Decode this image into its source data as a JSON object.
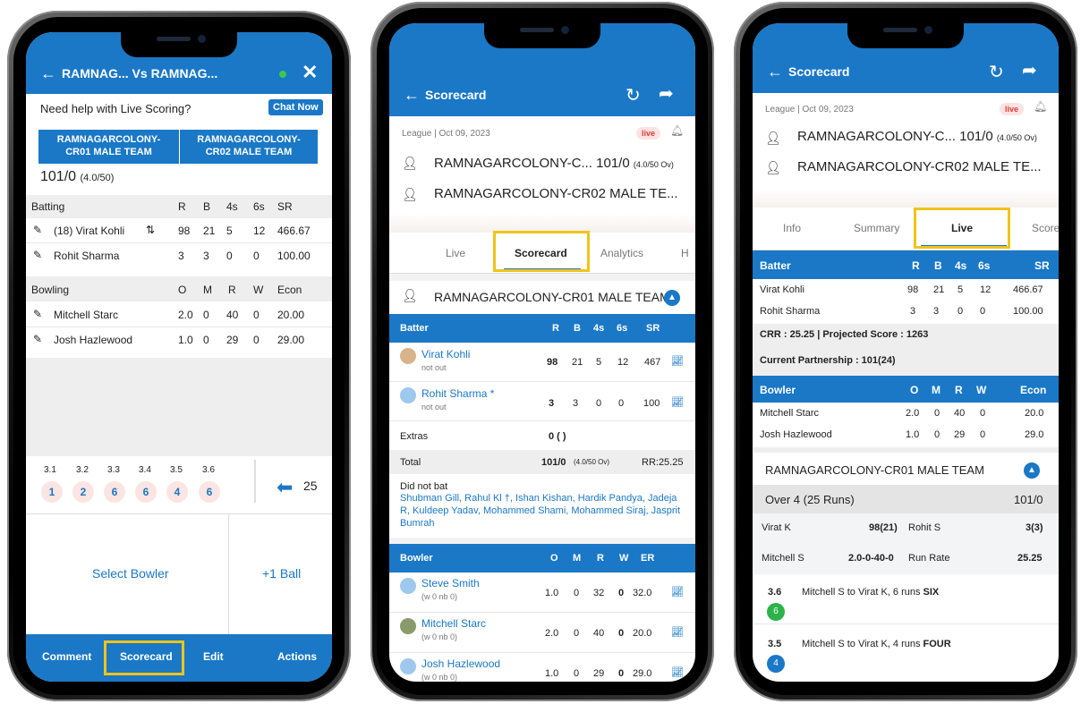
{
  "colors": {
    "accent": "#1a78c6",
    "highlight": "#f0c419",
    "live": "#e53935"
  },
  "p1": {
    "header_title": "RAMNAG... Vs RAMNAG...",
    "help_text": "Need help with Live Scoring?",
    "chat_now": "Chat Now",
    "team1": "RAMNAGARCOLONY-\nCR01 MALE TEAM",
    "team2": "RAMNAGARCOLONY-\nCR02 MALE TEAM",
    "score": "101/0",
    "overs": "(4.0/50)",
    "batting_headers": [
      "Batting",
      "R",
      "B",
      "4s",
      "6s",
      "SR"
    ],
    "batters": [
      {
        "name": "(18) Virat Kohli",
        "r": "98",
        "b": "21",
        "f": "5",
        "s": "12",
        "sr": "466.67"
      },
      {
        "name": "Rohit Sharma",
        "r": "3",
        "b": "3",
        "f": "0",
        "s": "0",
        "sr": "100.00"
      }
    ],
    "bowling_headers": [
      "Bowling",
      "O",
      "M",
      "R",
      "W",
      "Econ"
    ],
    "bowlers": [
      {
        "name": "Mitchell Starc",
        "o": "2.0",
        "m": "0",
        "r": "40",
        "w": "0",
        "e": "20.00"
      },
      {
        "name": "Josh Hazlewood",
        "o": "1.0",
        "m": "0",
        "r": "29",
        "w": "0",
        "e": "29.00"
      }
    ],
    "balls": [
      {
        "label": "3.1",
        "val": "1"
      },
      {
        "label": "3.2",
        "val": "2"
      },
      {
        "label": "3.3",
        "val": "6"
      },
      {
        "label": "3.4",
        "val": "6"
      },
      {
        "label": "3.5",
        "val": "4"
      },
      {
        "label": "3.6",
        "val": "6"
      }
    ],
    "undo_count": "25",
    "select_bowler": "Select Bowler",
    "plus_ball": "+1 Ball",
    "nav": [
      "Comment",
      "Scorecard",
      "Edit",
      "Actions"
    ]
  },
  "p2": {
    "header_title": "Scorecard",
    "meta": "League | Oct 09, 2023",
    "live": "live",
    "team1": "RAMNAGARCOLONY-C...",
    "team1_score": "101/0",
    "team1_overs": "(4.0/50 Ov)",
    "team2": "RAMNAGARCOLONY-CR02 MALE TE...",
    "tabs": [
      "Live",
      "Scorecard",
      "Analytics",
      "H"
    ],
    "innings_team": "RAMNAGARCOLONY-CR01 MALE TEAM",
    "batter_headers": [
      "Batter",
      "R",
      "B",
      "4s",
      "6s",
      "SR"
    ],
    "batters": [
      {
        "name": "Virat Kohli",
        "status": "not out",
        "r": "98",
        "b": "21",
        "f": "5",
        "s": "12",
        "sr": "467"
      },
      {
        "name": "Rohit Sharma *",
        "status": "not out",
        "r": "3",
        "b": "3",
        "f": "0",
        "s": "0",
        "sr": "100"
      }
    ],
    "extras_label": "Extras",
    "extras_value": "0 ( )",
    "total_label": "Total",
    "total_value": "101/0",
    "total_overs": "(4.0/50 Ov)",
    "rr": "RR:25.25",
    "dnb_label": "Did not bat",
    "dnb_list": "Shubman Gill, Rahul Kl †, Ishan Kishan, Hardik Pandya, Jadeja R, Kuldeep Yadav, Mohammed Shami, Mohammed Siraj, Jasprit Bumrah",
    "bowler_headers": [
      "Bowler",
      "O",
      "M",
      "R",
      "W",
      "ER"
    ],
    "bowlers": [
      {
        "name": "Steve Smith",
        "sub": "(w 0 nb 0)",
        "o": "1.0",
        "m": "0",
        "r": "32",
        "w": "0",
        "er": "32.0"
      },
      {
        "name": "Mitchell Starc",
        "sub": "(w 0 nb 0)",
        "o": "2.0",
        "m": "0",
        "r": "40",
        "w": "0",
        "er": "20.0"
      },
      {
        "name": "Josh Hazlewood",
        "sub": "(w 0 nb 0)",
        "o": "1.0",
        "m": "0",
        "r": "29",
        "w": "0",
        "er": "29.0"
      }
    ]
  },
  "p3": {
    "header_title": "Scorecard",
    "meta": "League | Oct 09, 2023",
    "live": "live",
    "team1": "RAMNAGARCOLONY-C...",
    "team1_score": "101/0",
    "team1_overs": "(4.0/50 Ov)",
    "team2": "RAMNAGARCOLONY-CR02 MALE TE...",
    "tabs": [
      "Info",
      "Summary",
      "Live",
      "Score"
    ],
    "batter_headers": [
      "Batter",
      "R",
      "B",
      "4s",
      "6s",
      "SR"
    ],
    "batters": [
      {
        "name": "Virat Kohli",
        "r": "98",
        "b": "21",
        "f": "5",
        "s": "12",
        "sr": "466.67"
      },
      {
        "name": "Rohit Sharma",
        "r": "3",
        "b": "3",
        "f": "0",
        "s": "0",
        "sr": "100.00"
      }
    ],
    "crr": "CRR : 25.25 | Projected Score : 1263",
    "partnership": "Current Partnership : 101(24)",
    "bowler_headers": [
      "Bowler",
      "O",
      "M",
      "R",
      "W",
      "Econ"
    ],
    "bowlers": [
      {
        "name": "Mitchell Starc",
        "o": "2.0",
        "m": "0",
        "r": "40",
        "w": "0",
        "e": "20.0"
      },
      {
        "name": "Josh Hazlewood",
        "o": "1.0",
        "m": "0",
        "r": "29",
        "w": "0",
        "e": "29.0"
      }
    ],
    "innings_team": "RAMNAGARCOLONY-CR01 MALE TEAM",
    "over_label": "Over 4 (25 Runs)",
    "over_score": "101/0",
    "p_bat1": "Virat K",
    "p_bat1_val": "98(21)",
    "p_bat2": "Rohit S",
    "p_bat2_val": "3(3)",
    "p_bowl": "Mitchell S",
    "p_bowl_val": "2.0-0-40-0",
    "rr_label": "Run Rate",
    "rr_val": "25.25",
    "comm": [
      {
        "over": "3.6",
        "text": "Mitchell S to Virat K, 6 runs ",
        "bold": "SIX",
        "ball": "6",
        "color": "#2db34a"
      },
      {
        "over": "3.5",
        "text": "Mitchell S to Virat K, 4 runs ",
        "bold": "FOUR",
        "ball": "4",
        "color": "#1a78c6"
      }
    ]
  }
}
